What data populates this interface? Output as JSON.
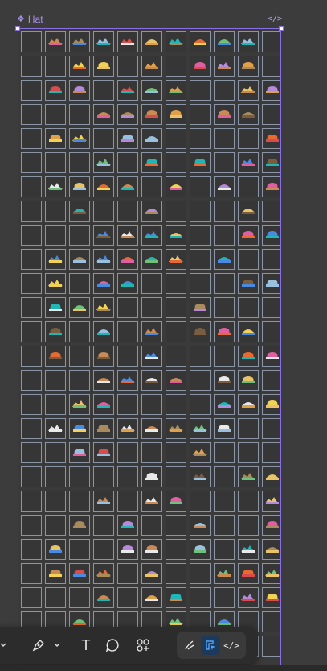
{
  "frame": {
    "title": "Hat",
    "component_icon": "component-diamond-icon",
    "badge": "</>",
    "accent": "#8a6ee8"
  },
  "grid": {
    "columns": 11,
    "rows": 26,
    "sprite_palette": [
      "#e8c36a",
      "#20b6b6",
      "#e9e9e9",
      "#d84c4c",
      "#c98a55",
      "#e0a04a",
      "#b58ad8",
      "#4a8ae0",
      "#e05fa0",
      "#6fc07a",
      "#a98a5c",
      "#f2d255",
      "#e86a30",
      "#9ac0e0",
      "#7a5d3e"
    ]
  },
  "toolbar": {
    "tools": [
      {
        "name": "pen-tool-icon",
        "label": ""
      },
      {
        "name": "text-tool-icon",
        "label": "T"
      },
      {
        "name": "comment-tool-icon",
        "label": ""
      },
      {
        "name": "plugins-tool-icon",
        "label": ""
      }
    ],
    "modes": [
      {
        "name": "draw-mode-icon"
      },
      {
        "name": "design-mode-icon",
        "active": true
      },
      {
        "name": "dev-mode-icon",
        "label": "</>"
      }
    ]
  }
}
